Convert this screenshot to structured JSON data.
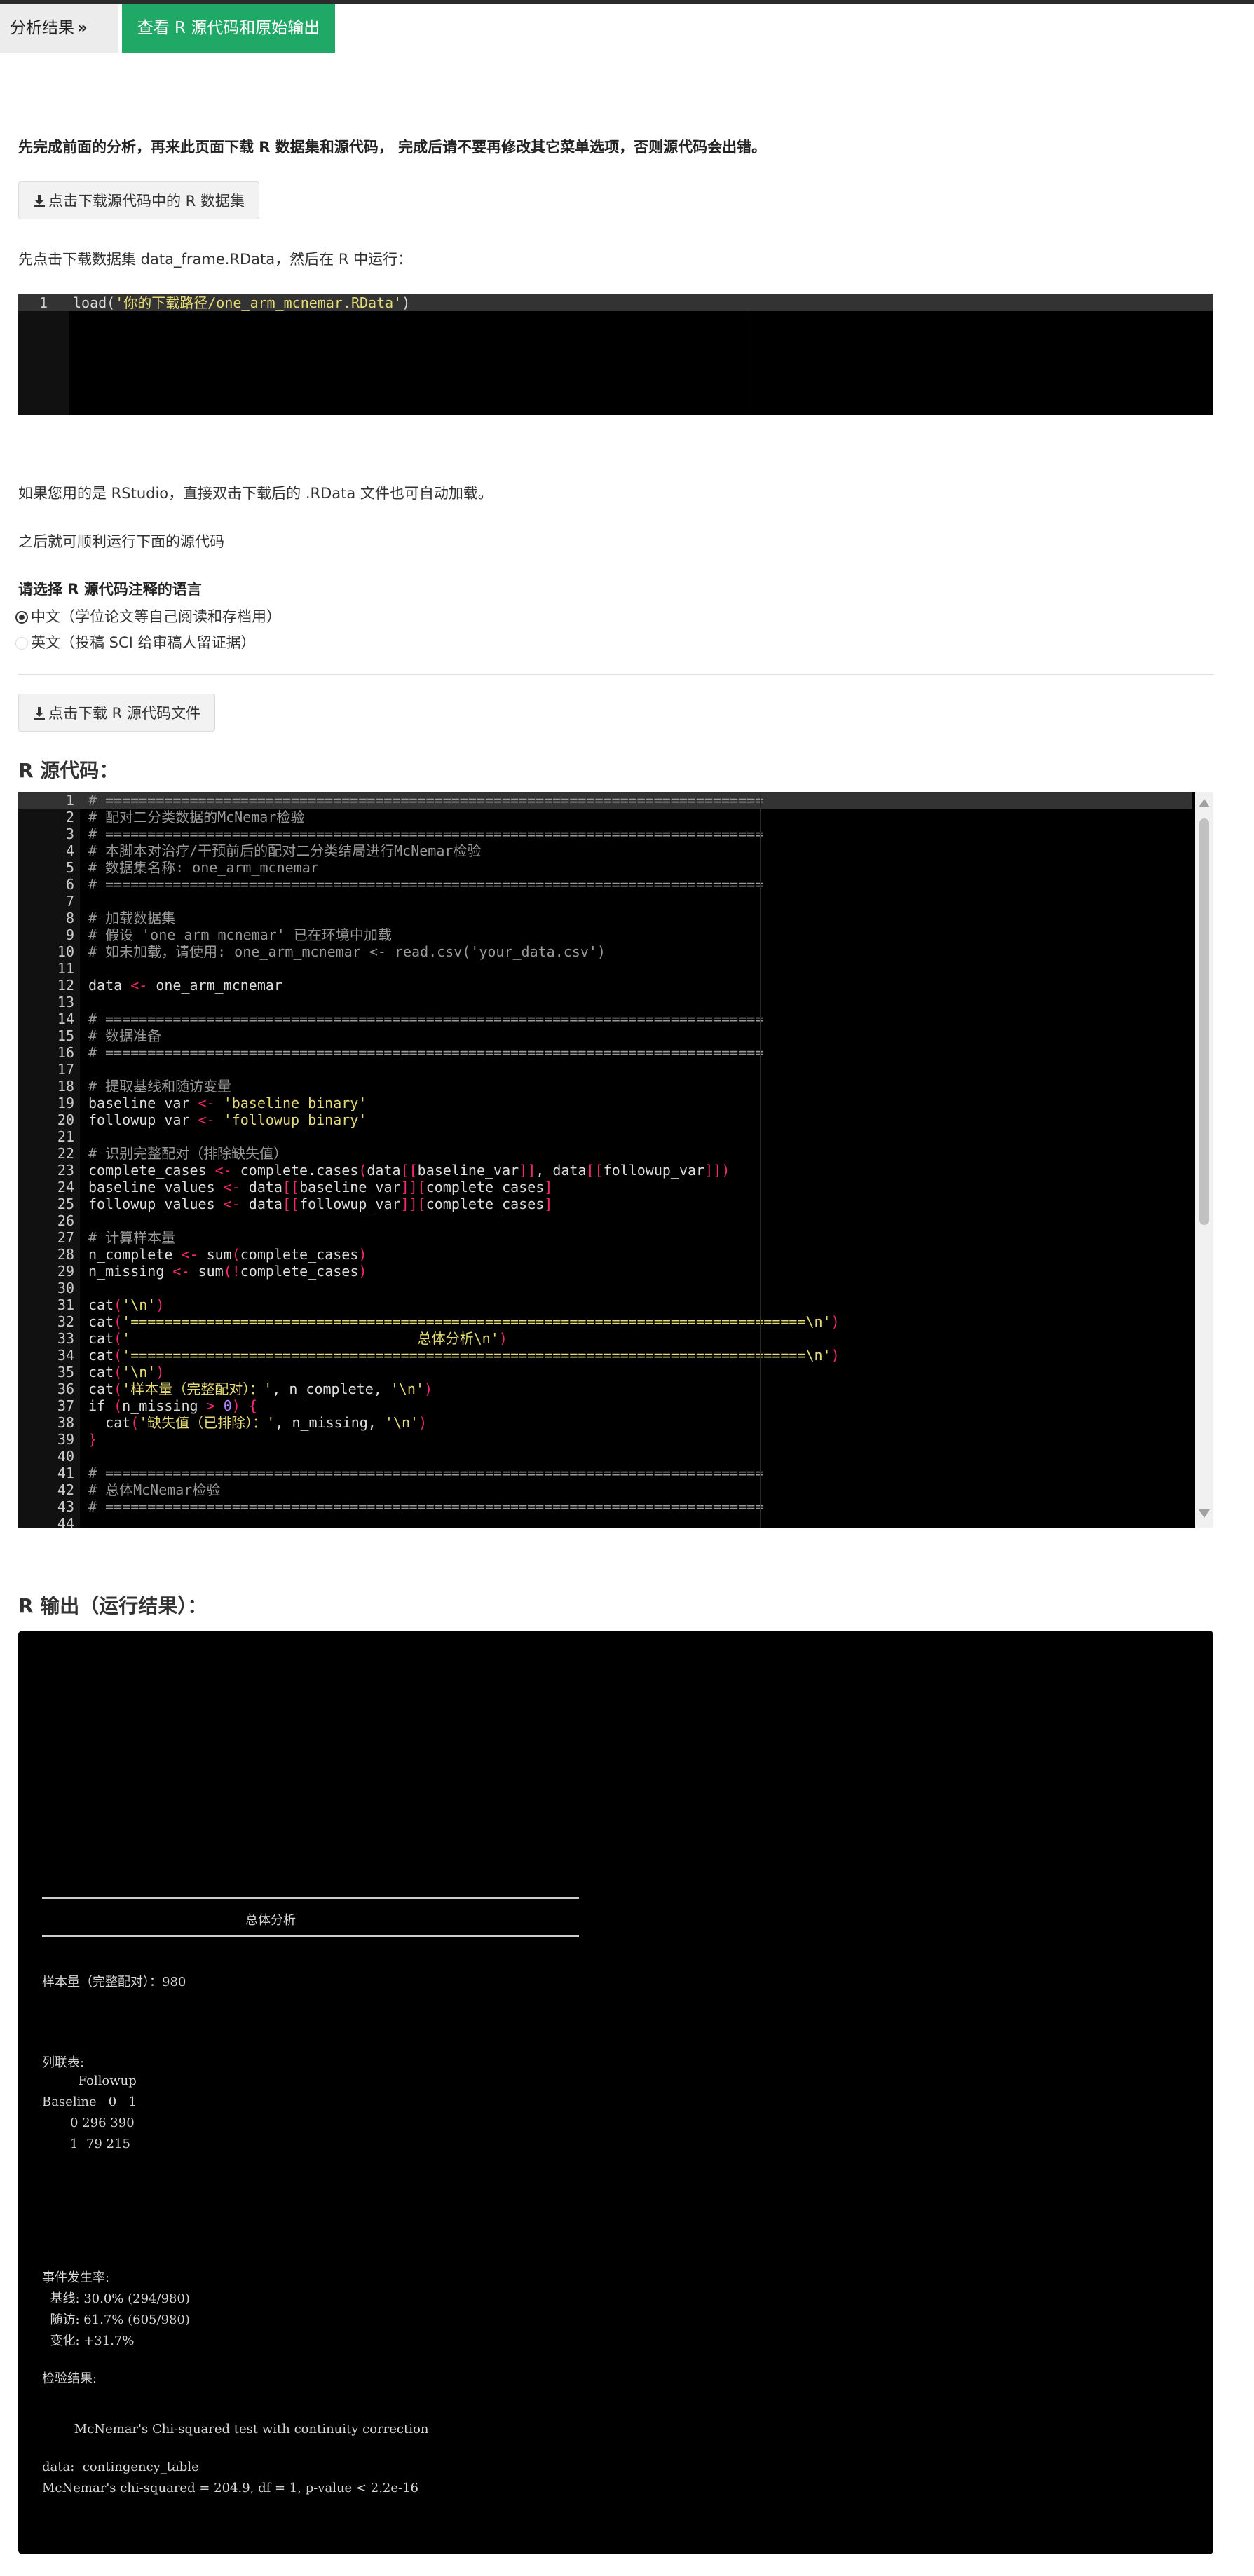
{
  "tabs": {
    "analysis_label": "分析结果",
    "analysis_glyph": "»",
    "source_label": "查看 R 源代码和原始输出"
  },
  "intro_text": "先完成前面的分析，再来此页面下载 R 数据集和源代码， 完成后请不要再修改其它菜单选项，否则源代码会出错。",
  "download_dataset_button": "点击下载源代码中的 R 数据集",
  "load_instruction": "先点击下载数据集 data_frame.RData，然后在 R 中运行：",
  "load_code": {
    "line_number": "1",
    "prefix": "load(",
    "string": "'你的下载路径/one_arm_mcnemar.RData'",
    "suffix": ")"
  },
  "rstudio_note": "如果您用的是 RStudio，直接双击下载后的 .RData 文件也可自动加载。",
  "run_note": "之后就可顺利运行下面的源代码",
  "language_label": "请选择 R 源代码注释的语言",
  "language_options": [
    {
      "label": "中文（学位论文等自己阅读和存档用）",
      "selected": true
    },
    {
      "label": "英文（投稿 SCI 给审稿人留证据）",
      "selected": false
    }
  ],
  "download_source_button": "点击下载 R 源代码文件",
  "source_heading": "R 源代码：",
  "source_lines": [
    "# ==============================================================================",
    "# 配对二分类数据的McNemar检验",
    "# ==============================================================================",
    "# 本脚本对治疗/干预前后的配对二分类结局进行McNemar检验",
    "# 数据集名称: one_arm_mcnemar",
    "# ==============================================================================",
    "",
    "# 加载数据集",
    "# 假设 'one_arm_mcnemar' 已在环境中加载",
    "# 如未加载，请使用: one_arm_mcnemar <- read.csv('your_data.csv')",
    "",
    "data <- one_arm_mcnemar",
    "",
    "# ==============================================================================",
    "# 数据准备",
    "# ==============================================================================",
    "",
    "# 提取基线和随访变量",
    "baseline_var <- 'baseline_binary'",
    "followup_var <- 'followup_binary'",
    "",
    "# 识别完整配对（排除缺失值）",
    "complete_cases <- complete.cases(data[[baseline_var]], data[[followup_var]])",
    "baseline_values <- data[[baseline_var]][complete_cases]",
    "followup_values <- data[[followup_var]][complete_cases]",
    "",
    "# 计算样本量",
    "n_complete <- sum(complete_cases)",
    "n_missing <- sum(!complete_cases)",
    "",
    "cat('\\n')",
    "cat('================================================================================\\n')",
    "cat('                                  总体分析\\n')",
    "cat('================================================================================\\n')",
    "cat('\\n')",
    "cat('样本量（完整配对）：', n_complete, '\\n')",
    "if (n_missing > 0) {",
    "  cat('缺失值（已排除）：', n_missing, '\\n')",
    "}",
    "",
    "# ==============================================================================",
    "# 总体McNemar检验",
    "# ==============================================================================",
    "",
    ""
  ],
  "output_heading": "R 输出（运行结果）：",
  "output": {
    "section_title": "总体分析",
    "sample_size": "样本量（完整配对）：980",
    "table_label": "列联表:",
    "table_lines": [
      "         Followup",
      "Baseline   0   1",
      "       0 296 390",
      "       1  79 215"
    ],
    "rate_label": "事件发生率:",
    "rate_lines": [
      "  基线: 30.0% (294/980)",
      "  随访: 61.7% (605/980)",
      "  变化: +31.7%"
    ],
    "test_label": "检验结果:",
    "test_title": "        McNemar's Chi-squared test with continuity correction",
    "data_line": "data:  contingency_table",
    "stat_line": "McNemar's chi-squared = 204.9, df = 1, p-value < 2.2e-16"
  }
}
